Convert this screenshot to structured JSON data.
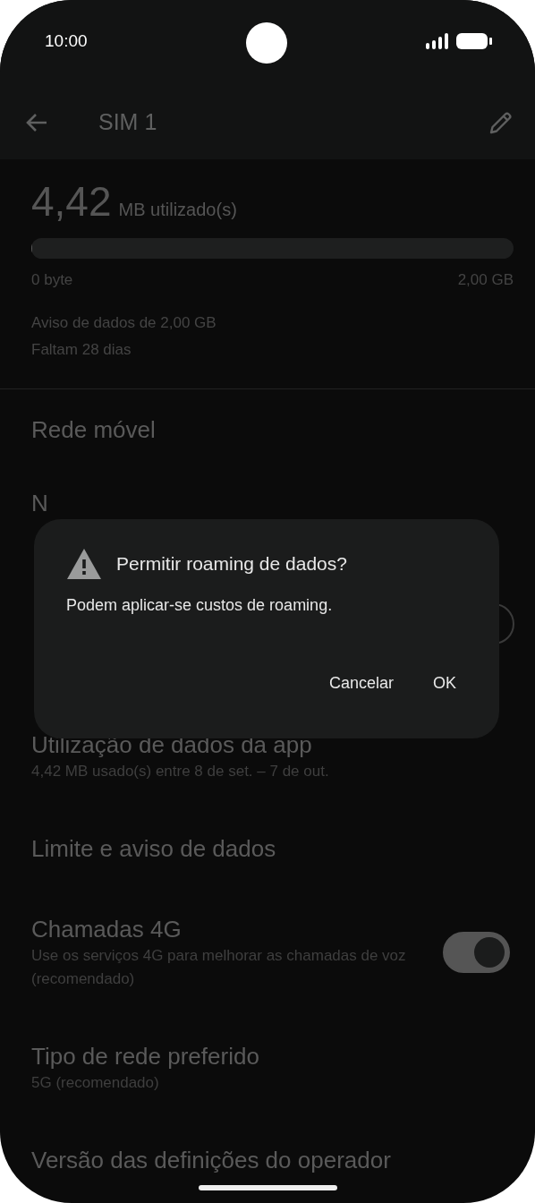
{
  "status_bar": {
    "time": "10:00"
  },
  "toolbar": {
    "title": "SIM 1"
  },
  "usage": {
    "amount": "4,42",
    "unit": "MB utilizado(s)",
    "level": 0.002,
    "min_label": "0 byte",
    "max_label": "2,00 GB",
    "warning": "Aviso de dados de 2,00 GB",
    "days_left": "Faltam 28 dias"
  },
  "section_title": "Rede móvel",
  "items": [
    {
      "kind": "text",
      "title": "N"
    },
    {
      "kind": "toggle",
      "on": false
    },
    {
      "kind": "text",
      "title": "Utilização de dados da app",
      "subtitle": "4,42 MB usado(s) entre 8 de set. – 7 de out."
    },
    {
      "kind": "text",
      "title": "Limite e aviso de dados"
    },
    {
      "kind": "toggle",
      "title": "Chamadas 4G",
      "subtitle": "Use os serviços 4G para melhorar as chamadas de voz (recomendado)",
      "on": true
    },
    {
      "kind": "text",
      "title": "Tipo de rede preferido",
      "subtitle": "5G (recomendado)"
    },
    {
      "kind": "text",
      "title": "Versão das definições do operador"
    }
  ],
  "dialog": {
    "title": "Permitir roaming de dados?",
    "message": "Podem aplicar-se custos de roaming.",
    "buttons": [
      "Cancelar",
      "OK"
    ]
  }
}
